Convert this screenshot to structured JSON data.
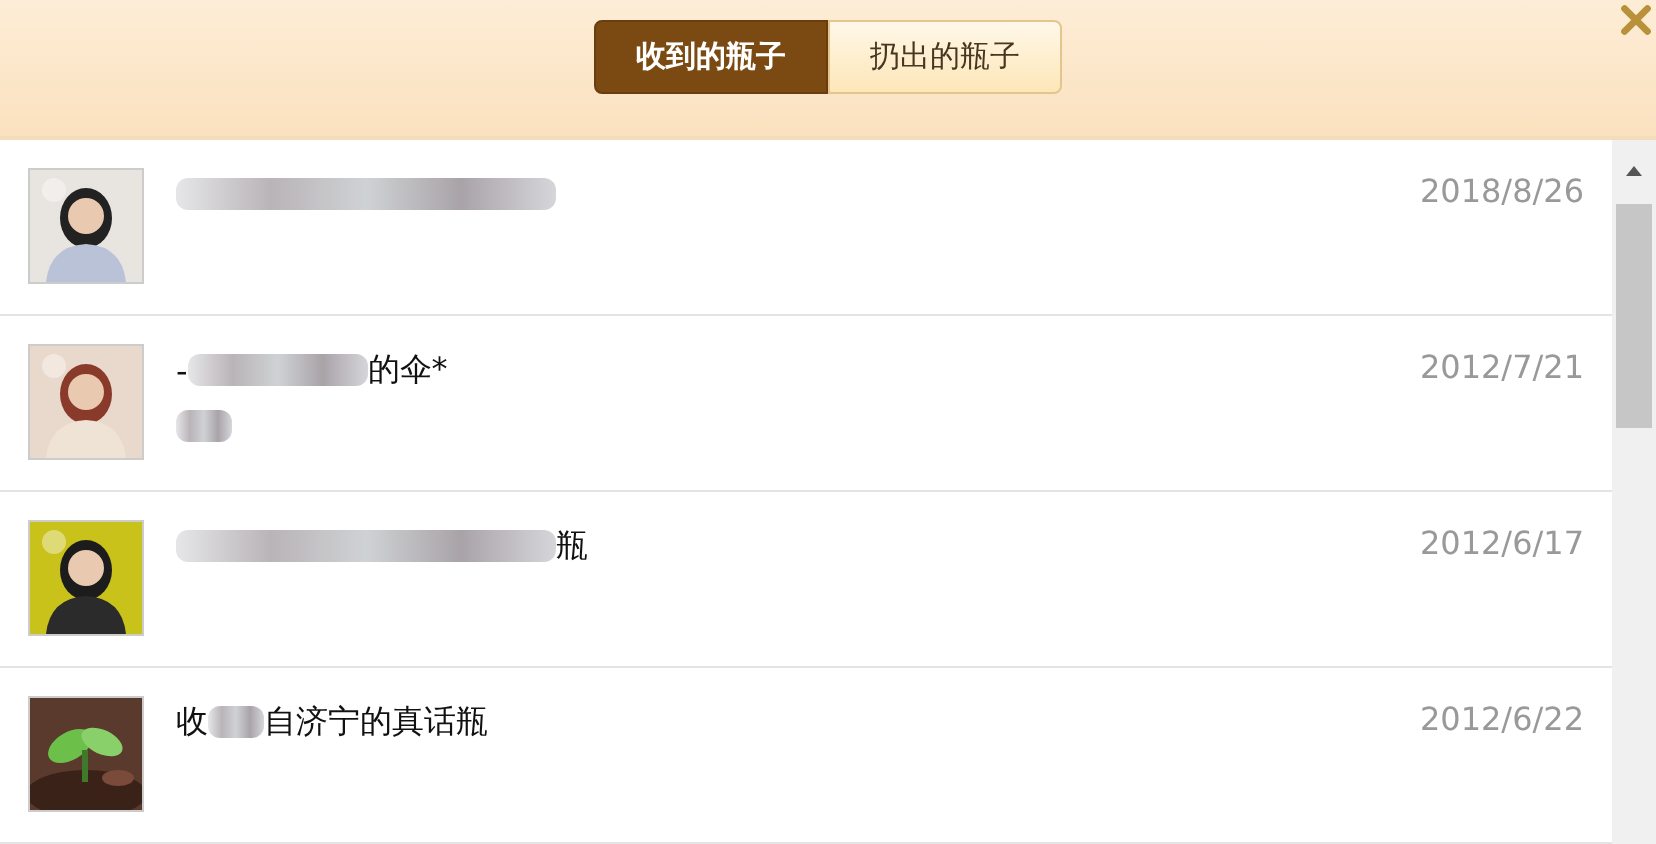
{
  "tabs": [
    {
      "label": "收到的瓶子",
      "selected": true
    },
    {
      "label": "扔出的瓶子",
      "selected": false
    }
  ],
  "rows": [
    {
      "avatar": {
        "kind": "picture"
      },
      "date": "2018/8/26",
      "lines": [
        [
          {
            "kind": "long-blur"
          }
        ]
      ]
    },
    {
      "avatar": {
        "kind": "picture"
      },
      "date": "2012/7/21",
      "lines": [
        [
          {
            "kind": "text",
            "text": "-"
          },
          {
            "kind": "medium-blur"
          },
          {
            "kind": "text",
            "text": "的伞*"
          }
        ],
        [
          {
            "kind": "short-blur"
          }
        ]
      ]
    },
    {
      "avatar": {
        "kind": "picture"
      },
      "date": "2012/6/17",
      "lines": [
        [
          {
            "kind": "long-blur"
          },
          {
            "kind": "text",
            "text": "瓶"
          }
        ]
      ]
    },
    {
      "avatar": {
        "kind": "picture"
      },
      "date": "2012/6/22",
      "lines": [
        [
          {
            "kind": "text",
            "text": "收"
          },
          {
            "kind": "short-blur"
          },
          {
            "kind": "text",
            "text": "自济宁的真话瓶"
          }
        ]
      ]
    }
  ]
}
